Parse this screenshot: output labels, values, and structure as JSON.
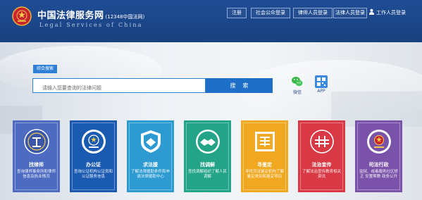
{
  "header": {
    "title": "中国法律服务网",
    "title_sub": "(12348中国法网)",
    "subtitle_en": "Legal Services of China",
    "nav": [
      {
        "label": "注册"
      },
      {
        "label": "社会公众登录"
      },
      {
        "label": "律师人员登录"
      },
      {
        "label": "法律人员登录"
      }
    ],
    "login_label": "工作人员登录"
  },
  "search": {
    "tab_label": "综合搜索",
    "placeholder": "请输入您要查询的法律问题",
    "button_label": "搜索"
  },
  "apps": [
    {
      "name": "wechat-icon",
      "label": "微信"
    },
    {
      "name": "app-icon",
      "label": "APP"
    }
  ],
  "cards": [
    {
      "title": "找律师",
      "desc": "查询律师事务所和律师信息及执业情况",
      "color": "#4d6bc1",
      "icon": "lawyer-emblem-icon"
    },
    {
      "title": "办公证",
      "desc": "查询公证机构公证员和公证服务信息",
      "color": "#1a5ab1",
      "icon": "notary-emblem-icon"
    },
    {
      "title": "求法援",
      "desc": "了解法律援助条件和申请法律援助中心",
      "color": "#2d9bd1",
      "icon": "legal-aid-shield-icon"
    },
    {
      "title": "找调解",
      "desc": "查找调解组织了解人民调解",
      "color": "#23a489",
      "icon": "mediation-handshake-icon"
    },
    {
      "title": "寻鉴定",
      "desc": "寻找司法鉴定机构了解鉴定类别和鉴定项目",
      "color": "#efa81f",
      "icon": "appraisal-seal-icon"
    },
    {
      "title": "法治宣传",
      "desc": "了解法治宣传教育相关资讯",
      "color": "#d93944",
      "icon": "publicity-icon"
    },
    {
      "title": "司法行政",
      "desc": "监狱、戒毒服务社区矫正 安置帮教 政务公开",
      "color": "#7b52a9",
      "icon": "justice-emblem-icon"
    }
  ]
}
